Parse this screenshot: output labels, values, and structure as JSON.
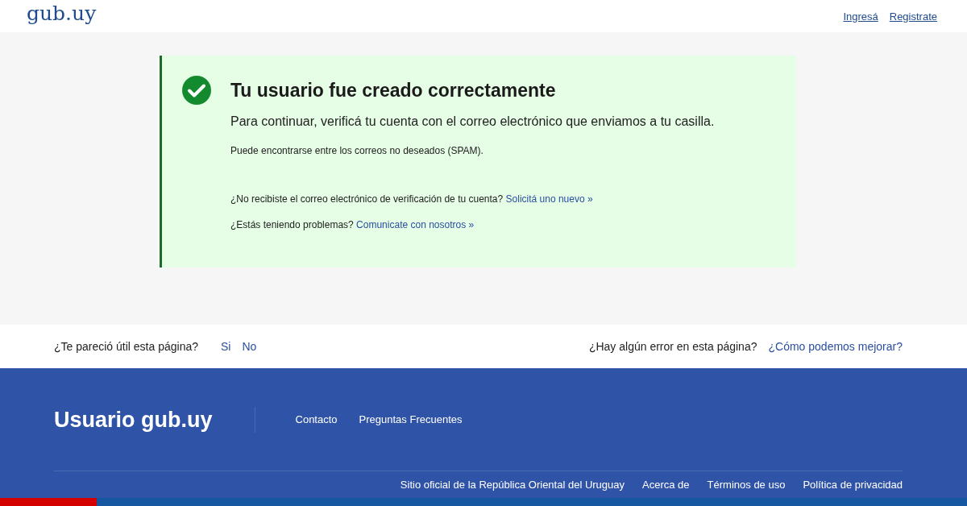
{
  "header": {
    "logo": "gub.uy",
    "links": [
      "Ingresá",
      "Registrate"
    ]
  },
  "message": {
    "kind": "success",
    "title": "Tu usuario fue creado correctamente",
    "lead": "Para continuar, verificá tu cuenta con el correo electrónico que enviamos a tu casilla.",
    "note": "Puede encontrarse entre los correos no deseados (SPAM).",
    "help": [
      {
        "text": "¿No recibiste el correo electrónico de verificación de tu cuenta?",
        "link": "Solicitá uno nuevo »"
      },
      {
        "text": "¿Estás teniendo problemas?",
        "link": "Comunicate con nosotros »"
      }
    ]
  },
  "feedback": {
    "question": "¿Te pareció útil esta página?",
    "answers": [
      "Si",
      "No"
    ],
    "error_question": "¿Hay algún error en esta página?",
    "error_link": "¿Cómo podemos mejorar?"
  },
  "footer": {
    "title": "Usuario gub.uy",
    "links": [
      "Contacto",
      "Preguntas Frecuentes"
    ],
    "bottom_links": [
      "Sitio oficial de la República Oriental del Uruguay",
      "Acerca de",
      "Términos de uso",
      "Política de privacidad"
    ]
  }
}
